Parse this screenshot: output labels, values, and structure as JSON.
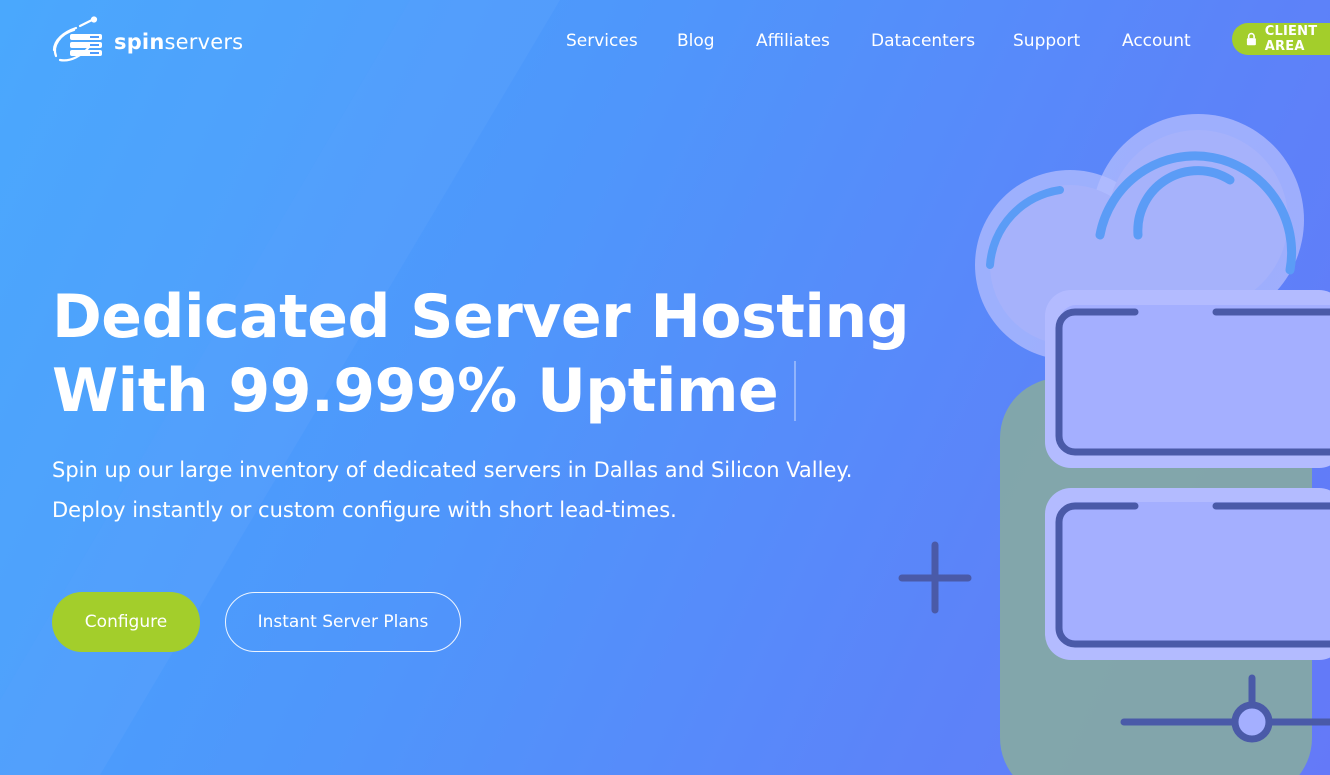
{
  "brand": {
    "name_bold": "spin",
    "name_regular": "servers"
  },
  "nav": {
    "items": [
      "Services",
      "Blog",
      "Affiliates",
      "Datacenters",
      "Support",
      "Account"
    ],
    "client_area_label": "CLIENT AREA"
  },
  "hero": {
    "title_line1": "Dedicated Server Hosting",
    "title_line2": "With 99.999% Uptime",
    "subtitle_line1": "Spin up our large inventory of dedicated servers in Dallas and Silicon Valley.",
    "subtitle_line2": "Deploy instantly or custom configure with short lead-times.",
    "configure_label": "Configure",
    "plans_label": "Instant Server Plans"
  },
  "colors": {
    "accent_green": "#a3ce2b",
    "bg_start": "#45a6fd",
    "bg_end": "#6479f8"
  },
  "icons": {
    "logo": "spinservers-logo-icon",
    "lock": "lock-icon",
    "illustration": "cloud-server-illustration"
  }
}
